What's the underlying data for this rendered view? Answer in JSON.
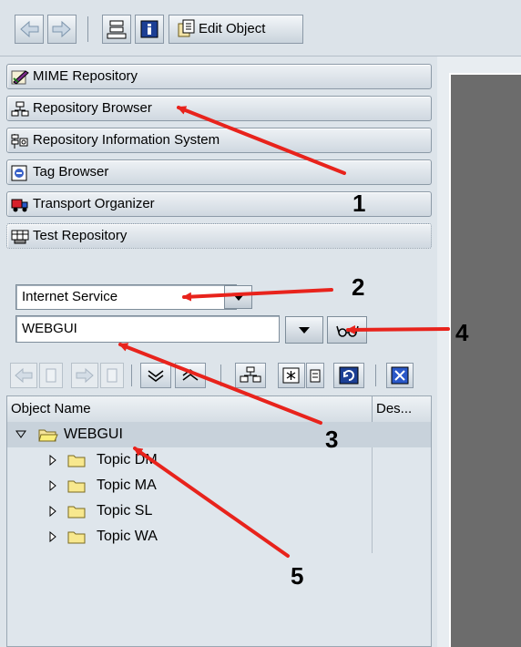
{
  "toolbar": {
    "back_icon": "back-arrow-icon",
    "forward_icon": "forward-arrow-icon",
    "hierarchy_icon": "hierarchy-icon",
    "info_icon": "info-icon",
    "edit_object_label": "Edit Object"
  },
  "nav": {
    "items": [
      {
        "label": "MIME Repository",
        "icon": "mime-repository-icon"
      },
      {
        "label": "Repository Browser",
        "icon": "repository-browser-icon"
      },
      {
        "label": "Repository Information System",
        "icon": "repository-info-system-icon"
      },
      {
        "label": "Tag Browser",
        "icon": "tag-browser-icon"
      },
      {
        "label": "Transport Organizer",
        "icon": "transport-organizer-icon"
      },
      {
        "label": "Test Repository",
        "icon": "test-repository-icon"
      }
    ]
  },
  "selector": {
    "object_type": "Internet Service",
    "object_name": "WEBGUI"
  },
  "tree": {
    "columns": {
      "name": "Object Name",
      "desc": "Des..."
    },
    "root": "WEBGUI",
    "children": [
      "Topic DM",
      "Topic MA",
      "Topic SL",
      "Topic WA"
    ]
  },
  "annotations": [
    "1",
    "2",
    "3",
    "4",
    "5"
  ],
  "colors": {
    "arrow": "#e8231c",
    "accent": "#1c3f94"
  }
}
